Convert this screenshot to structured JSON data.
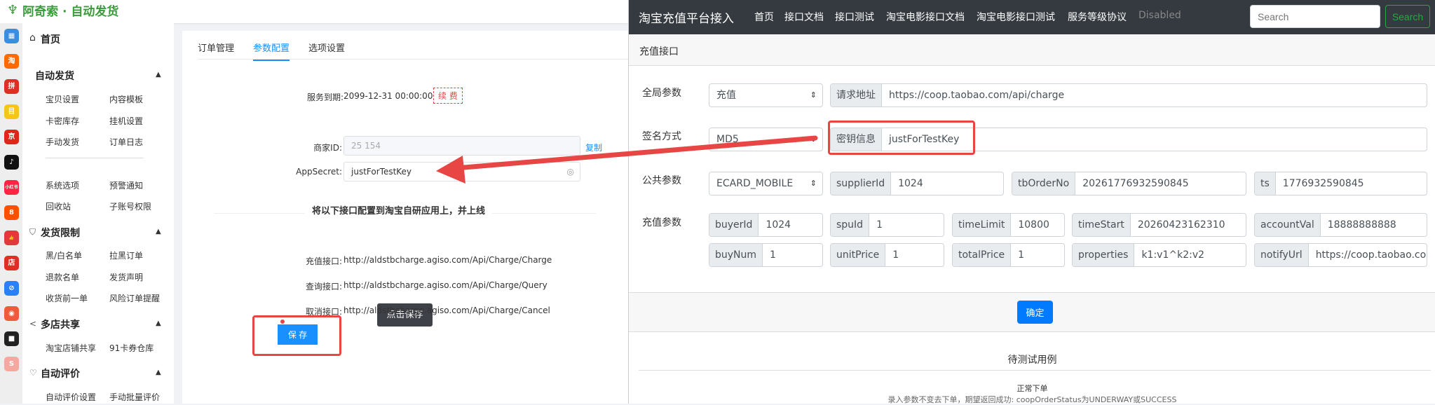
{
  "left": {
    "logo_text": "阿奇索 · 自动发货",
    "strip_icons": [
      {
        "name": "grid-icon",
        "color": "#3c8dde",
        "text": "▦"
      },
      {
        "name": "taobao-icon",
        "color": "#ff6a00",
        "text": "淘"
      },
      {
        "name": "pinduoduo-icon",
        "color": "#e02e24",
        "text": "拼"
      },
      {
        "name": "app-yellow-icon",
        "color": "#f5c518",
        "text": "目"
      },
      {
        "name": "jd-icon",
        "color": "#e1251b",
        "text": "京"
      },
      {
        "name": "douyin-icon",
        "color": "#111",
        "text": "♪"
      },
      {
        "name": "xiaohongshu-icon",
        "color": "#ff2442",
        "text": "小红书"
      },
      {
        "name": "app-orange-icon",
        "color": "#ff5000",
        "text": "8"
      },
      {
        "name": "thumb-icon",
        "color": "#e4393c",
        "text": "👍"
      },
      {
        "name": "shop-icon",
        "color": "#e02e24",
        "text": "店"
      },
      {
        "name": "link-icon",
        "color": "#2d7ff9",
        "text": "⊘"
      },
      {
        "name": "app-red-icon",
        "color": "#f05a3c",
        "text": "◉"
      },
      {
        "name": "app-black-icon",
        "color": "#222",
        "text": "■"
      },
      {
        "name": "app-pink-icon",
        "color": "#f4a8a0",
        "text": "S"
      }
    ],
    "sidebar": {
      "home": "首页",
      "groups": [
        {
          "title": "自动发货",
          "items": [
            "宝贝设置",
            "内容模板",
            "卡密库存",
            "挂机设置",
            "手动发货",
            "订单日志"
          ]
        },
        {
          "title": "",
          "items": [
            "系统选项",
            "预警通知",
            "回收站",
            "子账号权限"
          ]
        },
        {
          "title": "发货限制",
          "items": [
            "黑/白名单",
            "拉黑订单",
            "退款名单",
            "发货声明",
            "收货前一单",
            "风险订单提醒"
          ]
        },
        {
          "title": "多店共享",
          "items": [
            "淘宝店铺共享",
            "91卡券仓库"
          ]
        },
        {
          "title": "自动评价",
          "items": [
            "自动评价设置",
            "手动批量评价"
          ]
        }
      ]
    },
    "tabs": [
      "订单管理",
      "参数配置",
      "选项设置"
    ],
    "active_tab": "参数配置",
    "service_label": "服务到期:",
    "service_date": "2099-12-31 00:00:00",
    "renew": "续 费",
    "merchant_label": "商家ID:",
    "merchant_value": "25        154",
    "copy": "复制",
    "appsecret_label": "AppSecret:",
    "appsecret_value": "justForTestKey",
    "divider_title": "将以下接口配置到淘宝自研应用上，并上线",
    "interfaces": [
      {
        "label": "充值接口:",
        "url": "http://aldstbcharge.agiso.com/Api/Charge/Charge"
      },
      {
        "label": "查询接口:",
        "url": "http://aldstbcharge.agiso.com/Api/Charge/Query"
      },
      {
        "label": "取消接口:",
        "url": "http://aldstbcharge.agiso.com/Api/Charge/Cancel"
      }
    ],
    "save": "保 存",
    "tooltip": "点击保存",
    "accent": "#1890ff",
    "highlight": "#e84545"
  },
  "right": {
    "brand": "淘宝充值平台接入",
    "nav": [
      "首页",
      "接口文档",
      "接口测试",
      "淘宝电影接口文档",
      "淘宝电影接口测试",
      "服务等级协议"
    ],
    "nav_disabled": "Disabled",
    "search_placeholder": "Search",
    "search_button": "Search",
    "card_title": "充值接口",
    "row_labels": [
      "全局参数",
      "签名方式",
      "公共参数",
      "充值参数"
    ],
    "global_select": "充值",
    "request_url_label": "请求地址",
    "request_url": "https://coop.taobao.com/api/charge",
    "sign_select": "MD5",
    "secret_label": "密钥信息",
    "secret_value": "justForTestKey",
    "public_select": "ECARD_MOBILE",
    "public_params": [
      {
        "k": "supplierId",
        "v": "1024"
      },
      {
        "k": "tbOrderNo",
        "v": "20261776932590845"
      },
      {
        "k": "ts",
        "v": "1776932590845"
      }
    ],
    "charge_params_row1": [
      {
        "k": "buyerId",
        "v": "1024"
      },
      {
        "k": "spuId",
        "v": "1"
      },
      {
        "k": "timeLimit",
        "v": "10800"
      },
      {
        "k": "timeStart",
        "v": "20260423162310"
      },
      {
        "k": "accountVal",
        "v": "18888888888"
      }
    ],
    "charge_params_row2": [
      {
        "k": "buyNum",
        "v": "1"
      },
      {
        "k": "unitPrice",
        "v": "1"
      },
      {
        "k": "totalPrice",
        "v": "1"
      },
      {
        "k": "properties",
        "v": "k1:v1^k2:v2"
      },
      {
        "k": "notifyUrl",
        "v": "https://coop.taobao.com/api"
      }
    ],
    "confirm": "确定",
    "test_title": "待测试用例",
    "case_title": "正常下单",
    "case_desc": "录入参数不变去下单，期望返回成功: coopOrderStatus为UNDERWAY或SUCCESS"
  }
}
